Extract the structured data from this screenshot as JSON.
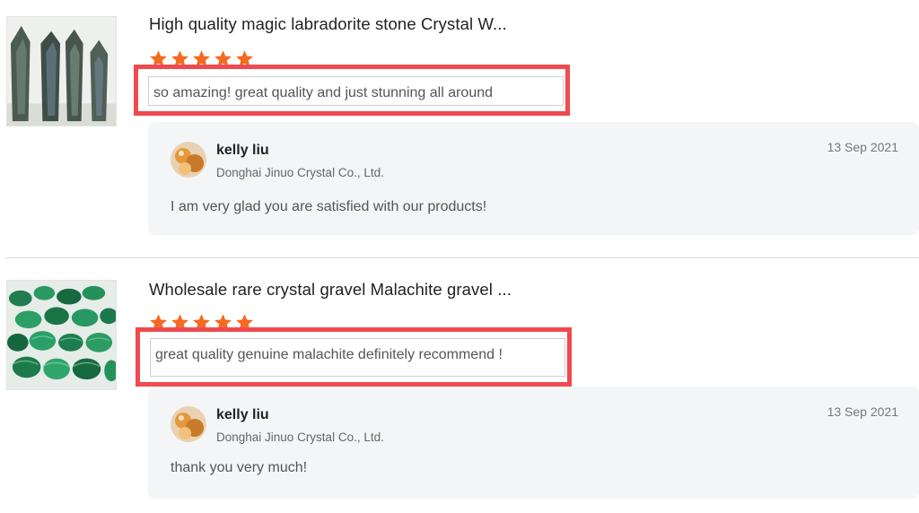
{
  "reviews": [
    {
      "product_title": "High quality magic labradorite stone Crystal W...",
      "rating": 5,
      "comment": "so amazing! great quality and just stunning all around",
      "reply": {
        "name": "kelly liu",
        "company": "Donghai Jinuo Crystal Co., Ltd.",
        "date": "13 Sep 2021",
        "text": "I am very glad you are satisfied with our products!"
      }
    },
    {
      "product_title": "Wholesale rare crystal gravel Malachite gravel ...",
      "rating": 5,
      "comment": "great quality genuine malachite definitely recommend !",
      "reply": {
        "name": "kelly liu",
        "company": "Donghai Jinuo Crystal Co., Ltd.",
        "date": "13 Sep 2021",
        "text": "thank you very much!"
      }
    }
  ],
  "colors": {
    "star": "#f56a1f",
    "highlight_border": "#f04a4f",
    "reply_bg": "#f4f5f7"
  },
  "icons": {
    "star": "star-icon"
  }
}
